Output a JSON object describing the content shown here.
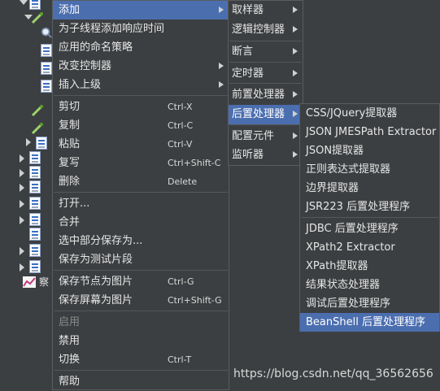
{
  "tree": {
    "node_labels": [
      "",
      "",
      "",
      "",
      "",
      "",
      "",
      "",
      "",
      "察"
    ]
  },
  "menu_main": {
    "items": [
      {
        "label": "添加",
        "shortcut": "",
        "submenu": true
      },
      {
        "label": "为子线程添加响应时间",
        "shortcut": "",
        "submenu": false
      },
      {
        "label": "应用的命名策略",
        "shortcut": "",
        "submenu": false
      },
      {
        "label": "改变控制器",
        "shortcut": "",
        "submenu": true
      },
      {
        "label": "插入上级",
        "shortcut": "",
        "submenu": true
      },
      {
        "label": "剪切",
        "shortcut": "Ctrl-X",
        "submenu": false
      },
      {
        "label": "复制",
        "shortcut": "Ctrl-C",
        "submenu": false
      },
      {
        "label": "粘贴",
        "shortcut": "Ctrl-V",
        "submenu": false
      },
      {
        "label": "复写",
        "shortcut": "Ctrl+Shift-C",
        "submenu": false
      },
      {
        "label": "删除",
        "shortcut": "Delete",
        "submenu": false
      },
      {
        "label": "打开...",
        "shortcut": "",
        "submenu": false
      },
      {
        "label": "合并",
        "shortcut": "",
        "submenu": false
      },
      {
        "label": "选中部分保存为...",
        "shortcut": "",
        "submenu": false
      },
      {
        "label": "保存为测试片段",
        "shortcut": "",
        "submenu": false
      },
      {
        "label": "保存节点为图片",
        "shortcut": "Ctrl-G",
        "submenu": false
      },
      {
        "label": "保存屏幕为图片",
        "shortcut": "Ctrl+Shift-G",
        "submenu": false
      },
      {
        "label": "启用",
        "shortcut": "",
        "submenu": false
      },
      {
        "label": "禁用",
        "shortcut": "",
        "submenu": false
      },
      {
        "label": "切换",
        "shortcut": "Ctrl-T",
        "submenu": false
      },
      {
        "label": "帮助",
        "shortcut": "",
        "submenu": false
      }
    ]
  },
  "menu_add": {
    "items": [
      {
        "label": "取样器"
      },
      {
        "label": "逻辑控制器"
      },
      {
        "label": "断言"
      },
      {
        "label": "定时器"
      },
      {
        "label": "前置处理器"
      },
      {
        "label": "后置处理器"
      },
      {
        "label": "配置元件"
      },
      {
        "label": "监听器"
      }
    ]
  },
  "menu_post": {
    "items": [
      {
        "label": "CSS/JQuery提取器"
      },
      {
        "label": "JSON JMESPath Extractor"
      },
      {
        "label": "JSON提取器"
      },
      {
        "label": "正则表达式提取器"
      },
      {
        "label": "边界提取器"
      },
      {
        "label": "JSR223 后置处理程序"
      },
      {
        "label": "JDBC 后置处理程序"
      },
      {
        "label": "XPath2 Extractor"
      },
      {
        "label": "XPath提取器"
      },
      {
        "label": "结果状态处理器"
      },
      {
        "label": "调试后置处理程序"
      },
      {
        "label": "BeanShell 后置处理程序"
      }
    ]
  },
  "watermark": "https://blog.csdn.net/qq_36562656",
  "colors": {
    "background": "#3c3f41",
    "selection": "#4b6eaf",
    "text": "#e6e6e6",
    "disabled": "#8a8a8a"
  }
}
